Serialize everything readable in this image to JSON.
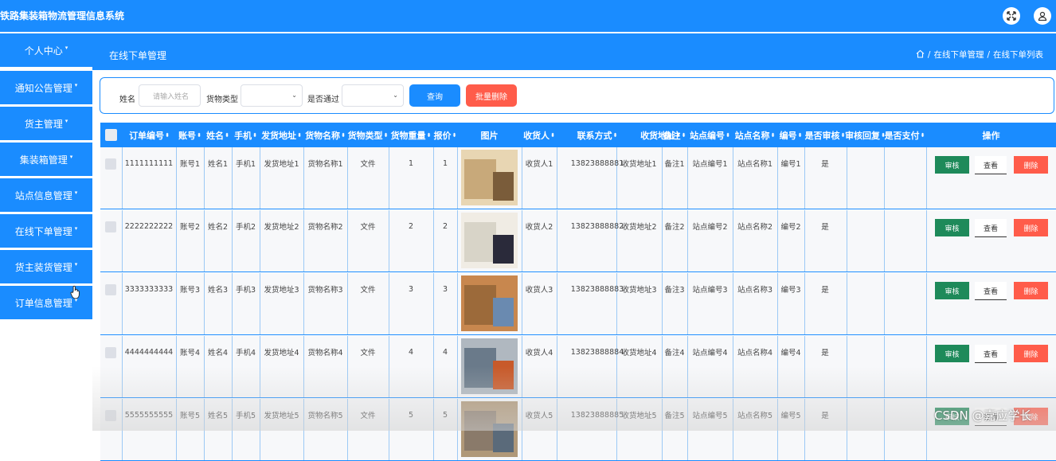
{
  "app": {
    "title": "铁路集装箱物流管理信息系统"
  },
  "sidebar": {
    "items": [
      {
        "label": "个人中心"
      },
      {
        "label": "通知公告管理"
      },
      {
        "label": "货主管理"
      },
      {
        "label": "集装箱管理"
      },
      {
        "label": "站点信息管理"
      },
      {
        "label": "在线下单管理"
      },
      {
        "label": "货主装货管理"
      },
      {
        "label": "订单信息管理"
      }
    ]
  },
  "page": {
    "title": "在线下单管理"
  },
  "breadcrumb": {
    "items": [
      "在线下单管理",
      "在线下单列表"
    ],
    "separator": "/"
  },
  "filter": {
    "name_label": "姓名",
    "name_placeholder": "请输入姓名",
    "type_label": "货物类型",
    "passed_label": "是否通过",
    "query_label": "查询",
    "bulk_delete_label": "批量删除"
  },
  "table": {
    "headers": [
      "订单编号",
      "账号",
      "姓名",
      "手机",
      "发货地址",
      "货物名称",
      "货物类型",
      "货物重量",
      "报价",
      "图片",
      "收货人",
      "联系方式",
      "收货地址",
      "备注",
      "站点编号",
      "站点名称",
      "编号",
      "是否审核",
      "审核回复",
      "是否支付",
      "操作"
    ],
    "rows": [
      {
        "order_no": "1111111111",
        "account": "账号1",
        "name": "姓名1",
        "phone": "手机1",
        "ship_addr": "发货地址1",
        "goods_name": "货物名称1",
        "goods_type": "文件",
        "weight": "1",
        "quote": "1",
        "receiver": "收货人1",
        "contact": "13823888881",
        "recv_addr": "收货地址1",
        "remark": "备注1",
        "station_no": "站点编号1",
        "station_name": "站点名称1",
        "code": "编号1",
        "audited": "是",
        "reply": "",
        "paid": ""
      },
      {
        "order_no": "2222222222",
        "account": "账号2",
        "name": "姓名2",
        "phone": "手机2",
        "ship_addr": "发货地址2",
        "goods_name": "货物名称2",
        "goods_type": "文件",
        "weight": "2",
        "quote": "2",
        "receiver": "收货人2",
        "contact": "13823888882",
        "recv_addr": "收货地址2",
        "remark": "备注2",
        "station_no": "站点编号2",
        "station_name": "站点名称2",
        "code": "编号2",
        "audited": "是",
        "reply": "",
        "paid": ""
      },
      {
        "order_no": "3333333333",
        "account": "账号3",
        "name": "姓名3",
        "phone": "手机3",
        "ship_addr": "发货地址3",
        "goods_name": "货物名称3",
        "goods_type": "文件",
        "weight": "3",
        "quote": "3",
        "receiver": "收货人3",
        "contact": "13823888883",
        "recv_addr": "收货地址3",
        "remark": "备注3",
        "station_no": "站点编号3",
        "station_name": "站点名称3",
        "code": "编号3",
        "audited": "是",
        "reply": "",
        "paid": ""
      },
      {
        "order_no": "4444444444",
        "account": "账号4",
        "name": "姓名4",
        "phone": "手机4",
        "ship_addr": "发货地址4",
        "goods_name": "货物名称4",
        "goods_type": "文件",
        "weight": "4",
        "quote": "4",
        "receiver": "收货人4",
        "contact": "13823888884",
        "recv_addr": "收货地址4",
        "remark": "备注4",
        "station_no": "站点编号4",
        "station_name": "站点名称4",
        "code": "编号4",
        "audited": "是",
        "reply": "",
        "paid": ""
      },
      {
        "order_no": "5555555555",
        "account": "账号5",
        "name": "姓名5",
        "phone": "手机5",
        "ship_addr": "发货地址5",
        "goods_name": "货物名称5",
        "goods_type": "文件",
        "weight": "5",
        "quote": "5",
        "receiver": "收货人5",
        "contact": "13823888885",
        "recv_addr": "收货地址5",
        "remark": "备注5",
        "station_no": "站点编号5",
        "station_name": "站点名称5",
        "code": "编号5",
        "audited": "是",
        "reply": "",
        "paid": ""
      }
    ],
    "actions": {
      "audit": "审核",
      "view": "查看",
      "delete": "删除"
    }
  },
  "watermark": {
    "text": "CSDN @嘉应学长"
  },
  "colors": {
    "primary": "#1a8cff",
    "danger": "#ff5c4a",
    "success": "#1e8a5a"
  }
}
